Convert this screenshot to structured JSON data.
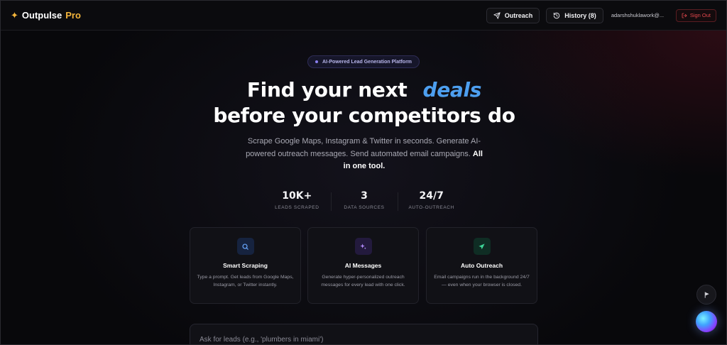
{
  "nav": {
    "brand_name": "Outpulse",
    "brand_suffix": "Pro",
    "brand_icon": "sparkle-icon",
    "outreach_label": "Outreach",
    "history_label": "History (8)",
    "user_email": "adarshshuklawork@...",
    "signout_label": "Sign Out"
  },
  "hero": {
    "badge": "AI-Powered Lead Generation Platform",
    "title_line1": "Find your next",
    "title_accent": "deals",
    "title_line2": "before your competitors do",
    "subtitle": "Scrape Google Maps, Instagram & Twitter in seconds. Generate AI-powered outreach messages. Send automated email campaigns.",
    "subtitle_bold": "All in one tool."
  },
  "stats": [
    {
      "value": "10K+",
      "label": "LEADS SCRAPED"
    },
    {
      "value": "3",
      "label": "DATA SOURCES"
    },
    {
      "value": "24/7",
      "label": "AUTO-OUTREACH"
    }
  ],
  "features": [
    {
      "icon": "search-icon",
      "title": "Smart Scraping",
      "description": "Type a prompt. Get leads from Google Maps, Instagram, or Twitter instantly."
    },
    {
      "icon": "sparkles-icon",
      "title": "AI Messages",
      "description": "Generate hyper-personalized outreach messages for every lead with one click."
    },
    {
      "icon": "send-icon",
      "title": "Auto Outreach",
      "description": "Email campaigns run in the background 24/7 — even when your browser is closed."
    }
  ],
  "search": {
    "placeholder": "Ask for leads (e.g., 'plumbers in miami')"
  },
  "colors": {
    "accent_blue": "#4d9ff0",
    "brand_gold": "#f4b53b",
    "signout_red": "#e5484d",
    "badge_purple": "#8b7ff0"
  }
}
